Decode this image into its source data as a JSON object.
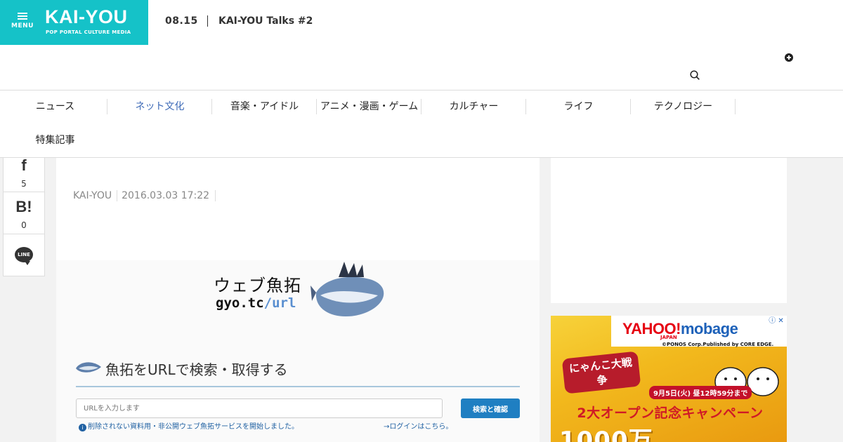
{
  "header": {
    "menu_label": "MENU",
    "logo_text": "KAI-YOU",
    "logo_sub": "POP PORTAL CULTURE MEDIA",
    "date": "08.15",
    "event_title": "KAI-YOU Talks #2"
  },
  "nav": {
    "items": [
      {
        "label": "ニュース"
      },
      {
        "label": "ネット文化"
      },
      {
        "label": "音楽・アイドル"
      },
      {
        "label": "アニメ・漫画・ゲーム"
      },
      {
        "label": "カルチャー"
      },
      {
        "label": "ライフ"
      },
      {
        "label": "テクノロジー"
      },
      {
        "label": "特集記事"
      }
    ],
    "active_index": 1
  },
  "share": {
    "facebook_count": "5",
    "hatena_label": "B!",
    "hatena_count": "0",
    "line_label": "LINE"
  },
  "article": {
    "author": "KAI-YOU",
    "date": "2016.03.03 17:22"
  },
  "screenshot": {
    "logo_text": "ウェブ魚拓",
    "url_prefix": "gyo.tc",
    "url_suffix": "/url",
    "heading": "魚拓をURLで検索・取得する",
    "input_placeholder": "URLを入力します",
    "button_label": "検索と確認",
    "notice": "削除されない資料用・非公開ウェブ魚拓サービスを開始しました。",
    "login_link": "→ログインはこちら。"
  },
  "ad": {
    "brand_part1": "YAHOO!",
    "brand_part2": "mobage",
    "brand_japan": "JAPAN",
    "credit": "©PONOS Corp.Published by CORE EDGE.",
    "controls": "ⓘ ✕",
    "game_title": "にゃんこ大戦争",
    "deadline": "9月5日(火) 昼12時59分まで",
    "campaign": "2大オープン記念キャンペーン",
    "big_text": "1000万"
  },
  "colors": {
    "brand_teal": "#15c2c8",
    "nav_active": "#3d6ab7",
    "button_blue": "#1f7fc2"
  }
}
